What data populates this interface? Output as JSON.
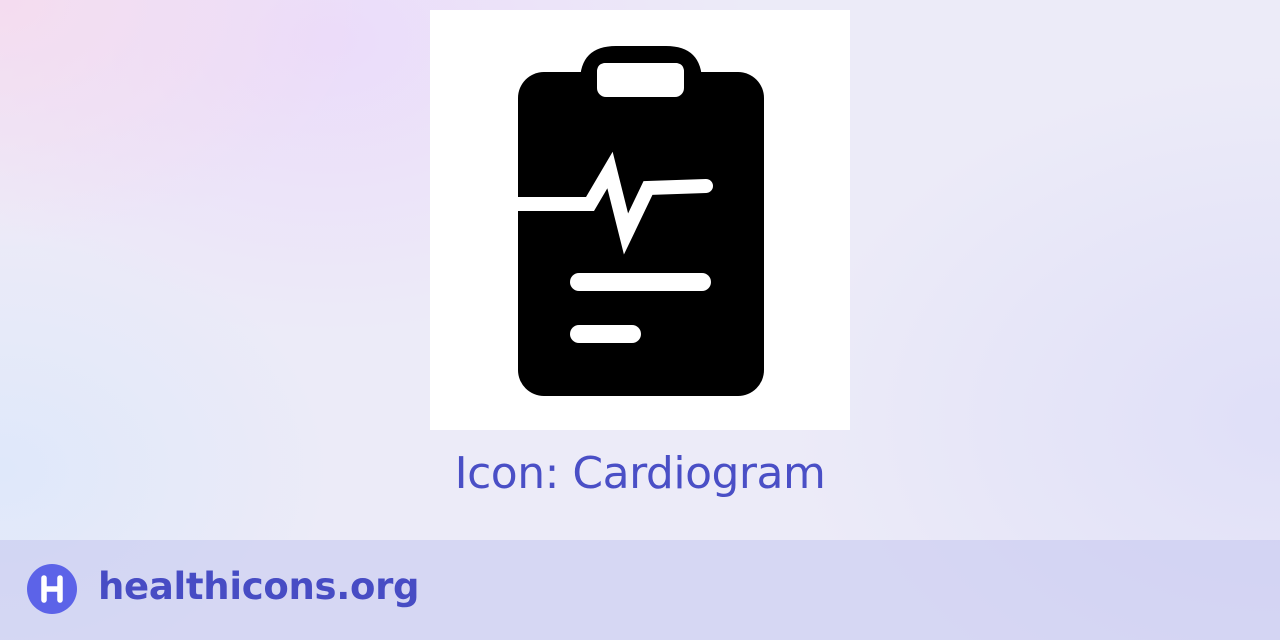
{
  "icon": {
    "name": "cardiogram-icon",
    "title": "Icon: Cardiogram"
  },
  "footer": {
    "logo_icon": "healthicons-logo-icon",
    "site_name": "healthicons.org"
  },
  "colors": {
    "title": "#4a4fc6",
    "site_name": "#474cc4",
    "logo": "#5c63e8",
    "icon": "#000000",
    "card": "#ffffff"
  }
}
